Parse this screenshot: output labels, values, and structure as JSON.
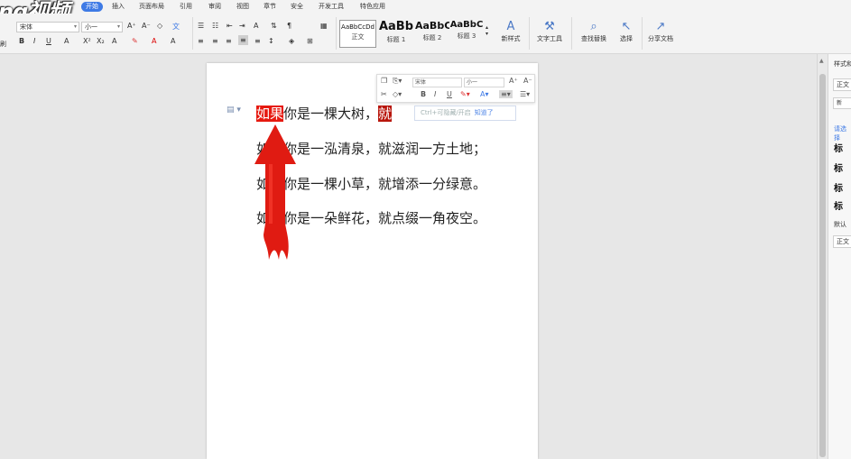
{
  "menu": {
    "logo": "ng视频",
    "tabs": [
      "开始",
      "插入",
      "页面布局",
      "引用",
      "审阅",
      "视图",
      "章节",
      "安全",
      "开发工具",
      "特色应用"
    ]
  },
  "ribbon": {
    "font_name": "宋体",
    "font_size": "小一",
    "styles": [
      {
        "sample": "AaBbCcDd",
        "name": "正文"
      },
      {
        "sample": "AaBb",
        "name": "标题 1"
      },
      {
        "sample": "AaBbC",
        "name": "标题 2"
      },
      {
        "sample": "AaBbC",
        "name": "标题 3"
      }
    ],
    "new_style": "新样式",
    "text_tools": "文字工具",
    "find_replace": "查找替换",
    "select": "选择",
    "share": "分享文档",
    "left_hint": "刷"
  },
  "document": {
    "lines": [
      {
        "pre_hl": "如果",
        "mid": "你是一棵大树，",
        "post_hl": "就"
      },
      {
        "text": "如果你是一泓清泉，就滋润一方土地；"
      },
      {
        "text": "如果你是一棵小草，就增添一分绿意。"
      },
      {
        "text": "如果你是一朵鲜花，就点缀一角夜空。"
      }
    ]
  },
  "mini_toolbar": {
    "font_name": "宋体",
    "font_size": "小一",
    "hint": "Ctrl+可隐藏/开启",
    "hint_link": "知道了"
  },
  "right_panel": {
    "title": "样式和",
    "current": "正文",
    "new_btn": "新",
    "pick_link": "请选择",
    "items": [
      "标",
      "标",
      "标",
      "标"
    ],
    "default_label": "默认",
    "bottom_box": "正文"
  },
  "colors": {
    "accent": "#3e7ae5",
    "highlight": "#e6190f",
    "arrow": "#e01b12"
  }
}
